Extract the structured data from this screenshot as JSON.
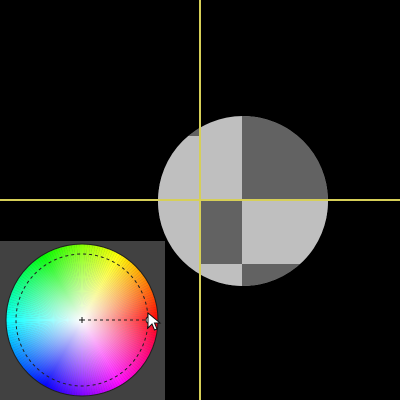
{
  "scene": {
    "background_color": "#000000",
    "guide_color": "#d6cf58",
    "sphere": {
      "light_color": "#bfbfbf",
      "dark_color": "#626262"
    }
  },
  "color_wheel": {
    "panel_color": "#414141",
    "ring_color": "#1f1f1f",
    "center_marker_icon": "crosshair-icon",
    "handle_icon": "picker-handle-icon",
    "cursor_icon": "mouse-pointer-icon",
    "selected_hue_deg": 0,
    "selected_saturation": 0.88
  }
}
